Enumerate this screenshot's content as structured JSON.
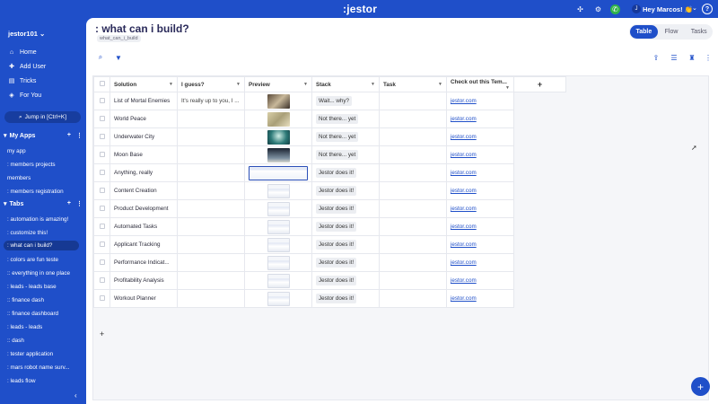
{
  "topbar": {
    "logo": ":jestor",
    "greeting": "Hey Marcos! 👏",
    "avatar_initial": "J",
    "help": "?"
  },
  "sidebar": {
    "workspace": "jestor101",
    "nav": [
      {
        "label": "Home",
        "icon": "home-icon",
        "glyph": "⌂"
      },
      {
        "label": "Add User",
        "icon": "user-plus-icon",
        "glyph": "👤"
      },
      {
        "label": "Tricks",
        "icon": "tricks-icon",
        "glyph": "▤"
      },
      {
        "label": "For You",
        "icon": "star-icon",
        "glyph": "◈"
      }
    ],
    "jump_label": "Jump in [Ctrl+K]",
    "my_apps": {
      "title": "My Apps",
      "items": [
        "my app",
        ": members projects",
        "members",
        ": members registration"
      ]
    },
    "tabs": {
      "title": "Tabs",
      "items": [
        ": automation is amazing!",
        ": customize this!",
        ": what can i build?",
        ": colors are fun teste",
        ":: everything in one place",
        ": leads - leads base",
        ":: finance dash",
        ":: finance dashboard",
        ": leads - leads",
        ":: dash",
        ": tester application",
        ": mars robot name surv...",
        ": leads flow"
      ],
      "active_index": 2
    }
  },
  "main": {
    "title": ": what can i build?",
    "slug": "what_can_i_build",
    "views": [
      "Table",
      "Flow",
      "Tasks"
    ],
    "active_view": "Table"
  },
  "table": {
    "columns": [
      "Solution",
      "I guess?",
      "Preview",
      "Stack",
      "Task",
      "Check out this Tem..."
    ],
    "rows": [
      {
        "solution": "List of Mortal Enemies",
        "guess": "It's really up to you, I ...",
        "preview": "photo-dark",
        "stack": "Wait... why?",
        "task": "",
        "link": "jestor.com"
      },
      {
        "solution": "World Peace",
        "guess": "",
        "preview": "photo-map",
        "stack": "Not there... yet",
        "task": "",
        "link": "jestor.com"
      },
      {
        "solution": "Underwater City",
        "guess": "",
        "preview": "photo-teal",
        "stack": "Not there... yet",
        "task": "",
        "link": "jestor.com"
      },
      {
        "solution": "Moon Base",
        "guess": "",
        "preview": "photo-moon",
        "stack": "Not there... yet",
        "task": "",
        "link": "jestor.com"
      },
      {
        "solution": "Anything, really",
        "guess": "",
        "preview": "screen-wide",
        "stack": "Jestor does it!",
        "task": "",
        "link": "jestor.com"
      },
      {
        "solution": "Content Creation",
        "guess": "",
        "preview": "screen",
        "stack": "Jestor does it!",
        "task": "",
        "link": "jestor.com"
      },
      {
        "solution": "Product Development",
        "guess": "",
        "preview": "screen",
        "stack": "Jestor does it!",
        "task": "",
        "link": "jestor.com"
      },
      {
        "solution": "Automated Tasks",
        "guess": "",
        "preview": "screen",
        "stack": "Jestor does it!",
        "task": "",
        "link": "jestor.com"
      },
      {
        "solution": "Applicant Tracking",
        "guess": "",
        "preview": "screen",
        "stack": "Jestor does it!",
        "task": "",
        "link": "jestor.com"
      },
      {
        "solution": "Performance Indicat...",
        "guess": "",
        "preview": "screen",
        "stack": "Jestor does it!",
        "task": "",
        "link": "jestor.com"
      },
      {
        "solution": "Profitability Analysis",
        "guess": "",
        "preview": "screen",
        "stack": "Jestor does it!",
        "task": "",
        "link": "jestor.com"
      },
      {
        "solution": "Workout Planner",
        "guess": "",
        "preview": "screen",
        "stack": "Jestor does it!",
        "task": "",
        "link": "jestor.com"
      }
    ],
    "add_row": "+",
    "add_column": "+"
  },
  "fab_label": "+",
  "colors": {
    "brand": "#1f4fc9",
    "link": "#1f4fc9"
  }
}
